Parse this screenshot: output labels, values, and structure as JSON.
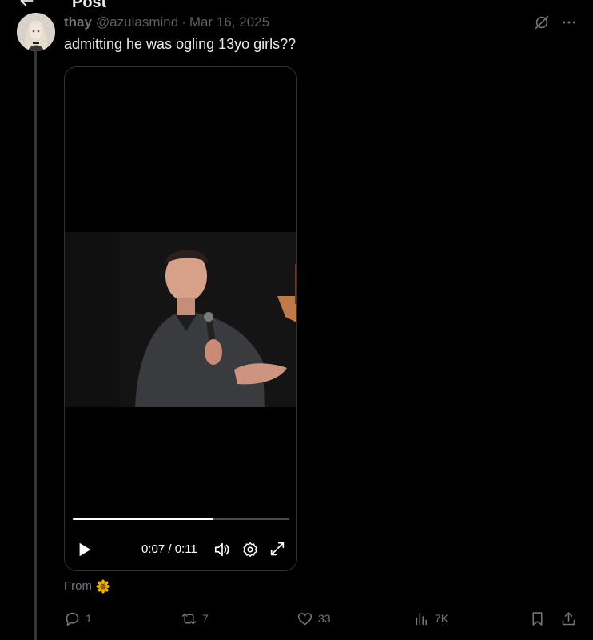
{
  "header": {
    "title": "Post",
    "back_icon": "arrow-left-icon"
  },
  "post": {
    "author_name": "thay",
    "author_handle": "@azulasmind",
    "separator": "·",
    "date": "Mar 16, 2025",
    "text": "admitting he was ogling 13yo girls??",
    "source_label": "From",
    "source_icon": "sunflower-emoji"
  },
  "video": {
    "time": "0:07 / 0:11",
    "progress": 0.65,
    "controls": [
      "play-icon",
      "volume-icon",
      "settings-icon",
      "fullscreen-icon"
    ]
  },
  "actions": {
    "replies": "1",
    "reposts": "7",
    "likes": "33",
    "views": "7K"
  },
  "colors": {
    "background": "#000000",
    "text": "#e7e9ea",
    "muted": "#71767b",
    "thread_line": "#333639"
  }
}
